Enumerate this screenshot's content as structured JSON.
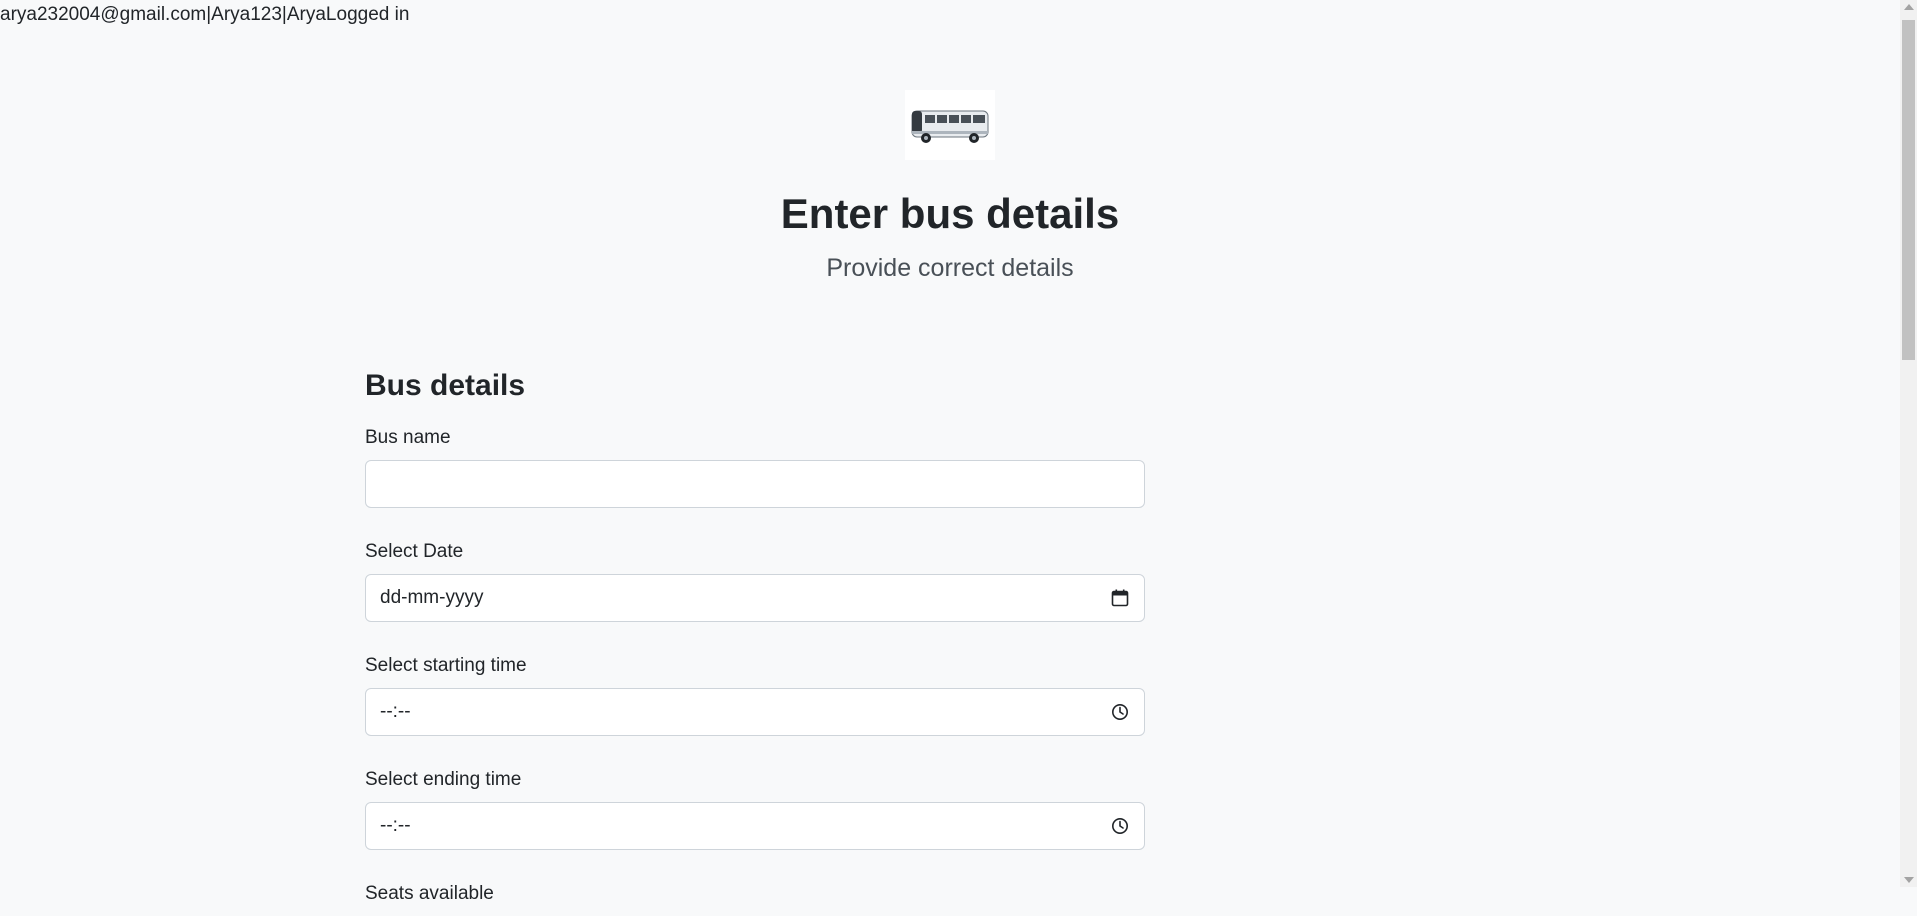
{
  "status": {
    "text": "arya232004@gmail.com|Arya123|AryaLogged in"
  },
  "logo": {
    "icon": "bus-image"
  },
  "header": {
    "title": "Enter bus details",
    "subtitle": "Provide correct details"
  },
  "form": {
    "title": "Bus details",
    "fields": [
      {
        "label": "Bus name",
        "value": "",
        "icon": ""
      },
      {
        "label": "Select Date",
        "value": "dd-mm-yyyy",
        "icon": "calendar-icon"
      },
      {
        "label": "Select starting time",
        "value": "--:--",
        "icon": "clock-icon"
      },
      {
        "label": "Select ending time",
        "value": "--:--",
        "icon": "clock-icon"
      },
      {
        "label": "Seats available",
        "value": "",
        "icon": ""
      }
    ]
  }
}
